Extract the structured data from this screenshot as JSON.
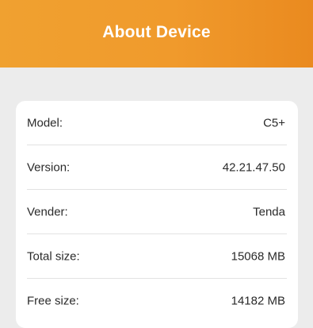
{
  "header": {
    "title": "About Device",
    "gradient_start": "#f0a130",
    "gradient_end": "#ea8a1f"
  },
  "device_info": {
    "rows": [
      {
        "label": "Model:",
        "value": "C5+"
      },
      {
        "label": "Version:",
        "value": "42.21.47.50"
      },
      {
        "label": "Vender:",
        "value": "Tenda"
      },
      {
        "label": "Total size:",
        "value": "15068 MB"
      },
      {
        "label": "Free size:",
        "value": "14182 MB"
      }
    ]
  }
}
